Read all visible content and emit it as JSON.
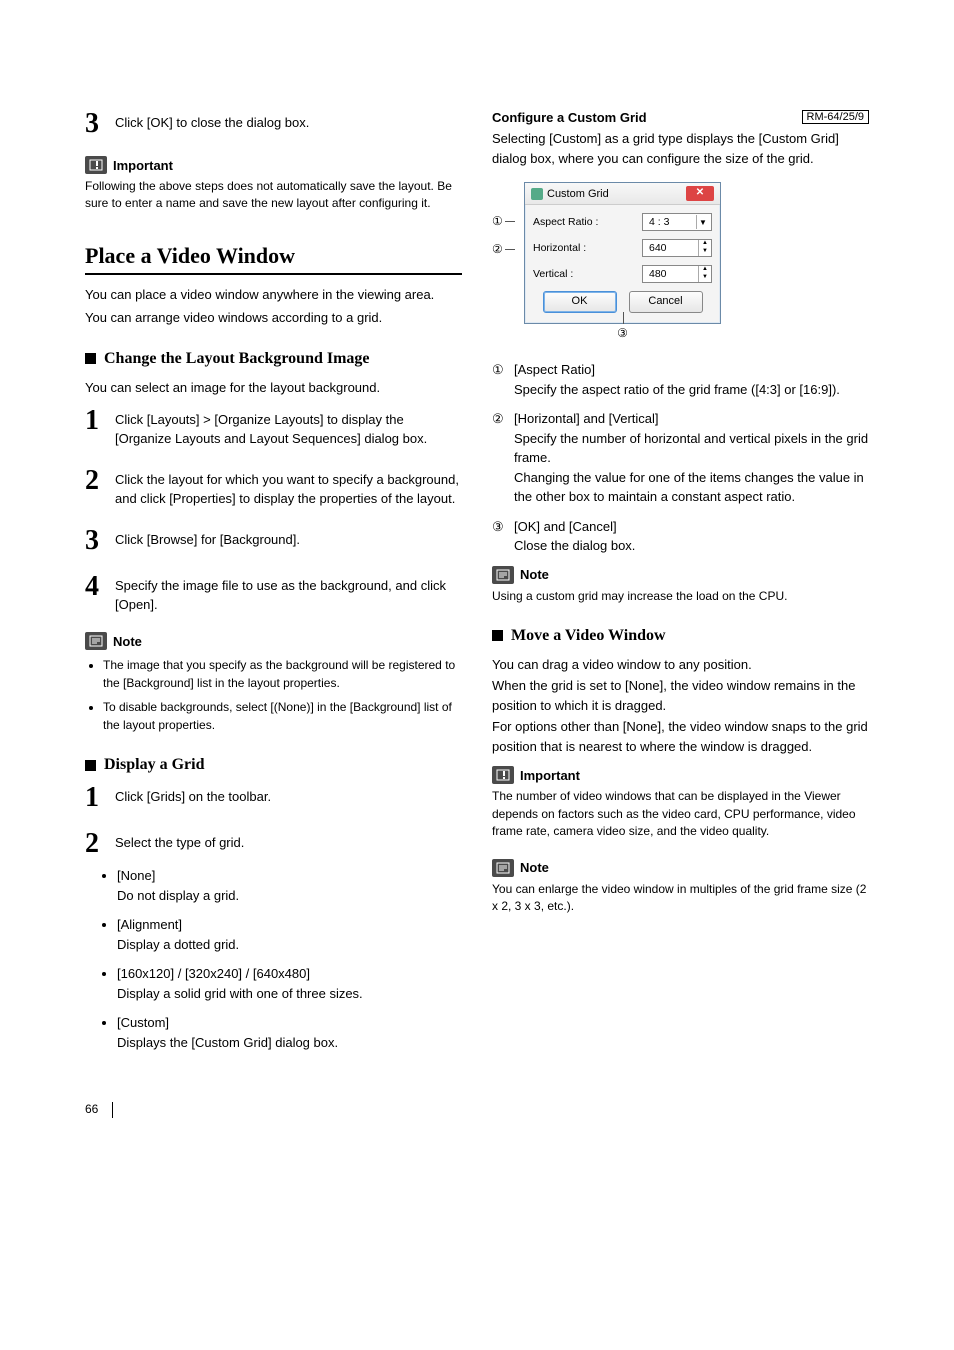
{
  "left": {
    "step3": "Click [OK] to close the dialog box.",
    "important_label": "Important",
    "important_body": "Following the above steps does not automatically save the layout. Be sure to enter a name and save the new layout after configuring it.",
    "section_place": "Place a Video Window",
    "place_p1": "You can place a video window anywhere in the viewing area.",
    "place_p2": "You can arrange video windows according to a grid.",
    "sub_change": "Change the Layout Background Image",
    "change_p": "You can select an image for the layout background.",
    "change_steps": {
      "s1": "Click [Layouts] > [Organize Layouts] to display the [Organize Layouts and Layout Sequences] dialog box.",
      "s2": "Click the layout for which you want to specify a background, and click [Properties] to display the properties of the layout.",
      "s3": "Click [Browse] for [Background].",
      "s4": "Specify the image file to use as the background, and click [Open]."
    },
    "note_label": "Note",
    "note_bullets": [
      "The image that you specify as the background will be registered to the [Background] list in the layout properties.",
      "To disable backgrounds, select [(None)] in the [Background] list of the layout properties."
    ],
    "sub_display": "Display a Grid",
    "display_steps": {
      "s1": "Click [Grids] on the toolbar.",
      "s2": "Select the type of grid."
    },
    "grid_opts": [
      {
        "label": "[None]",
        "desc": "Do not display a grid."
      },
      {
        "label": "[Alignment]",
        "desc": "Display a dotted grid."
      },
      {
        "label": "[160x120] / [320x240] / [640x480]",
        "desc": "Display a solid grid with one of three sizes."
      },
      {
        "label": "[Custom]",
        "desc": "Displays the [Custom Grid] dialog box."
      }
    ]
  },
  "right": {
    "title": "Configure a Custom Grid",
    "badge": "RM-64/25/9",
    "intro": "Selecting [Custom] as a grid type displays the [Custom Grid] dialog box, where you can configure the size of the grid.",
    "dialog": {
      "title": "Custom Grid",
      "aspect_label": "Aspect Ratio :",
      "aspect_value": "4 : 3",
      "horizontal_label": "Horizontal :",
      "horizontal_value": "640",
      "vertical_label": "Vertical :",
      "vertical_value": "480",
      "ok": "OK",
      "cancel": "Cancel"
    },
    "annos": {
      "a1": "①",
      "a2": "②",
      "a3": "③"
    },
    "defs": [
      {
        "num": "①",
        "label": "[Aspect Ratio]",
        "desc": "Specify the aspect ratio of the grid frame ([4:3] or [16:9])."
      },
      {
        "num": "②",
        "label": "[Horizontal] and [Vertical]",
        "desc": "Specify the number of horizontal and vertical pixels in the grid frame.\nChanging the value for one of the items changes the value in the other box to maintain a constant aspect ratio."
      },
      {
        "num": "③",
        "label": "[OK] and [Cancel]",
        "desc": "Close the dialog box."
      }
    ],
    "note_label": "Note",
    "note_body": "Using a custom grid may increase the load on the CPU.",
    "sub_move": "Move a Video Window",
    "move_p1": "You can drag a video window to any position.",
    "move_p2": "When the grid is set to [None], the video window remains in the position to which it is dragged.",
    "move_p3": "For options other than [None], the video window snaps to the grid position that is nearest to where the window is dragged.",
    "important_label": "Important",
    "important_body": "The number of video windows that can be displayed in the Viewer depends on factors such as the video card, CPU performance, video frame rate, camera video size, and the video quality.",
    "note2_body": "You can enlarge the video window in multiples of the grid frame size (2 x 2, 3 x 3, etc.)."
  },
  "page_number": "66"
}
